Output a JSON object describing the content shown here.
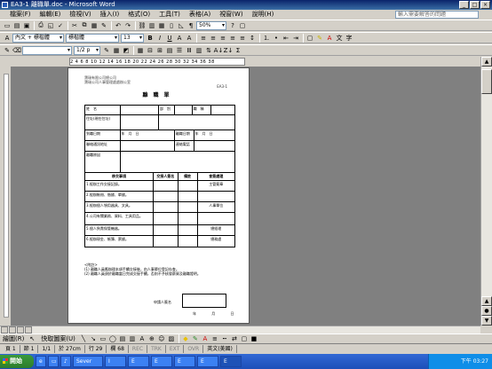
{
  "window": {
    "title": "EA3-1 離職單.doc - Microsoft Word",
    "controls": [
      "_",
      "□",
      "×"
    ]
  },
  "menu": {
    "items": [
      "檔案(F)",
      "編輯(E)",
      "檢視(V)",
      "插入(I)",
      "格式(O)",
      "工具(T)",
      "表格(A)",
      "視窗(W)",
      "說明(H)"
    ],
    "help_placeholder": "輸入需要解答的問題"
  },
  "toolbar": {
    "zoom": "50%",
    "style": "內文 + 標楷體",
    "font": "標楷體",
    "font_size": "13",
    "line_spacing": "1/2 p",
    "bold": "B",
    "italic": "I",
    "underline": "U"
  },
  "ruler": {
    "ticks": "2 4 6 8 10 12 14 16 18 20 22 24 26 28 30 32 34 36 38"
  },
  "document": {
    "company_line1": "寶瑞有限公司總公司",
    "company_line2": "寶瑞公司人事管理處處辦公室",
    "form_code": "EA3-1",
    "form_title": "離職單",
    "fields": {
      "name": "姓　名",
      "dept": "部　別",
      "position": "職　稱",
      "staff_no": "到職日期",
      "address": "住址(現在住址)",
      "onboard_date": "到職日期",
      "resign_date": "離職日期",
      "year_month_day": "年　月　日",
      "contact_address": "聯絡通訊地址",
      "phone": "連絡電話",
      "resign_reason": "離職原因"
    },
    "table_headers": [
      "移交事項",
      "交接人簽名",
      "備註",
      "會簽處理"
    ],
    "table_rows": [
      "1.經辦工作交接記錄。",
      "2.經辦帳冊、借據、單據。",
      "3.經辦個人領用器具、文具。",
      "4.公司有關業務、資料、工具用品。",
      "5.個人負責保管機器。",
      "6.經辦現金、帳簿、票據。"
    ],
    "signoff_labels": [
      "主管簽章",
      "人事單位",
      "總經理",
      "總務處"
    ],
    "notes_title": "<附註>",
    "notes": [
      "(1) 離職人員應辦理本項手續交接後，由人事單位登記存查。",
      "(2) 離職人員須於離職當日完成交接手續，否則不予核發薪資及離職證明。"
    ],
    "applicant_label": "申請人簽名",
    "date_label": "年 月 日"
  },
  "statusbar": {
    "page": "頁 1",
    "section": "節 1",
    "page_of": "1/1",
    "position": "於 27cm",
    "line": "行 29",
    "column": "欄 68",
    "modes": [
      "REC",
      "TRK",
      "EXT",
      "OVR"
    ],
    "language": "英文(美國)"
  },
  "drawing_toolbar": {
    "draw": "繪圖(R)",
    "autoshapes": "快取圖案(U)"
  },
  "taskbar": {
    "start": "開始",
    "tasks": [
      "Sever",
      "I",
      "E",
      "E",
      "E",
      "E",
      "E"
    ],
    "time": "下午 03:27"
  }
}
